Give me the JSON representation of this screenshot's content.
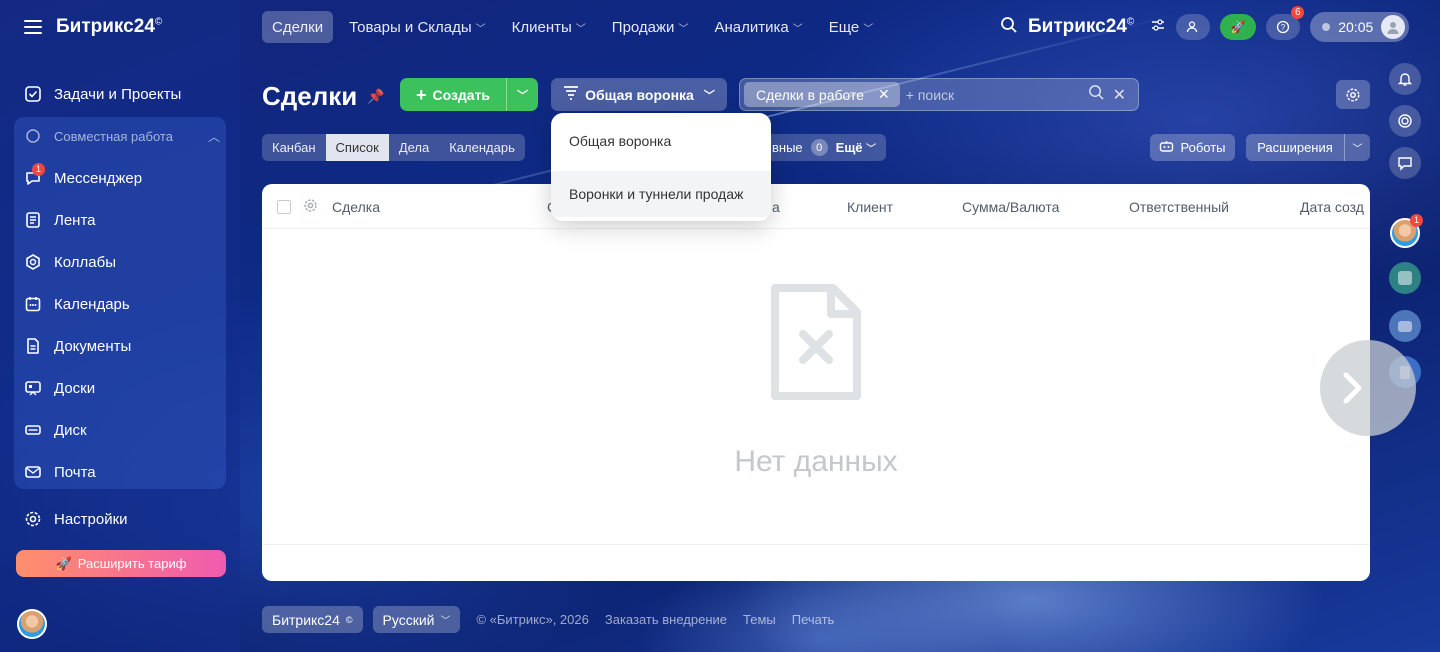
{
  "sidebar": {
    "logo": "Битрикс24",
    "logo_mark": "©",
    "top_item": "Задачи и Проекты",
    "group_title": "Совместная работа",
    "items": [
      {
        "label": "Мессенджер",
        "badge": "1"
      },
      {
        "label": "Лента"
      },
      {
        "label": "Коллабы"
      },
      {
        "label": "Календарь"
      },
      {
        "label": "Документы"
      },
      {
        "label": "Доски"
      },
      {
        "label": "Диск"
      },
      {
        "label": "Почта"
      }
    ],
    "settings": "Настройки",
    "upgrade": "Расширить тариф"
  },
  "topnav": {
    "items": [
      {
        "label": "Сделки",
        "active": true
      },
      {
        "label": "Товары и Склады"
      },
      {
        "label": "Клиенты"
      },
      {
        "label": "Продажи"
      },
      {
        "label": "Аналитика"
      },
      {
        "label": "Еще"
      }
    ],
    "brand": "Битрикс24",
    "brand_mark": "©",
    "help_badge": "6",
    "time": "20:05"
  },
  "page": {
    "title": "Сделки",
    "create": "Создать",
    "funnel": "Общая воронка",
    "filter_chip": "Сделки в работе",
    "search_placeholder": "+ поиск"
  },
  "views": [
    "Канбан",
    "Список",
    "Дела",
    "Календарь"
  ],
  "counters": {
    "partial_label": "вные",
    "count": "0",
    "more": "Ещё"
  },
  "robots": "Роботы",
  "extensions": "Расширения",
  "menu": {
    "items": [
      "Общая воронка",
      "Воронки и туннели продаж"
    ]
  },
  "grid": {
    "columns": [
      "Сделка",
      "С",
      "а",
      "Клиент",
      "Сумма/Валюта",
      "Ответственный",
      "Дата созд"
    ],
    "empty": "Нет данных"
  },
  "footer": {
    "brand": "Битрикс24",
    "brand_mark": "©",
    "language": "Русский",
    "copyright": "© «Битрикс», 2026",
    "links": [
      "Заказать внедрение",
      "Темы",
      "Печать"
    ]
  },
  "rail": {
    "avatar_badge": "1"
  },
  "colors": {
    "create": "#3bc25d",
    "badge": "#f0483e",
    "upgrade_from": "#ff8f6b",
    "upgrade_to": "#ef5bb0"
  }
}
